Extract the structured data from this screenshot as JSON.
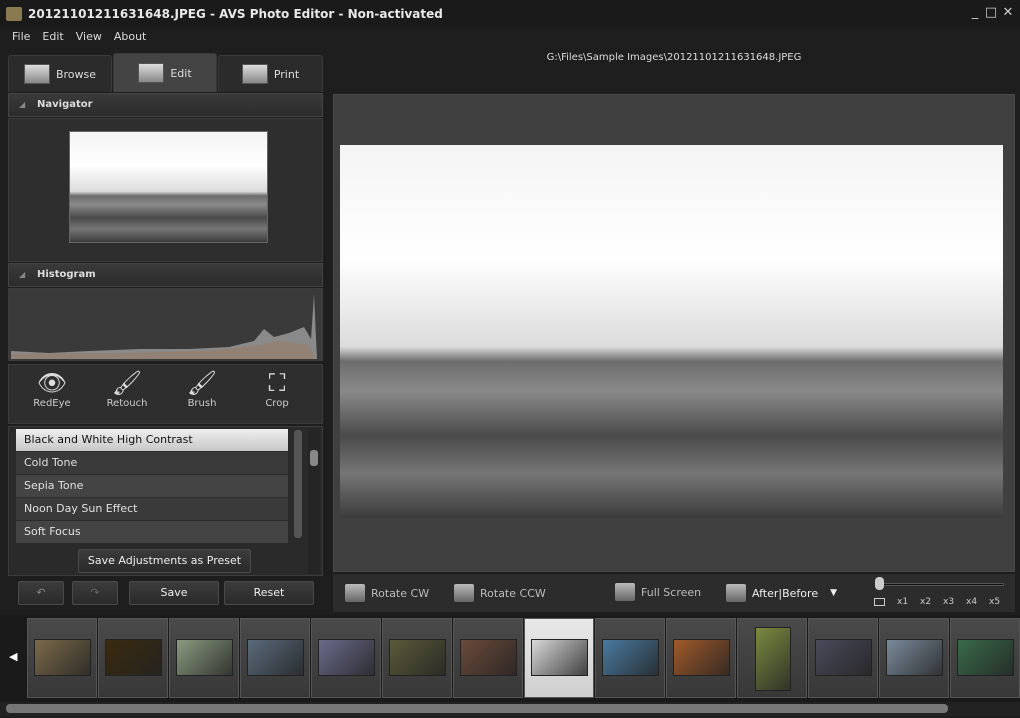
{
  "window": {
    "title": "20121101211631648.JPEG  -  AVS Photo Editor - Non-activated",
    "controls": [
      "minimize",
      "maximize",
      "close"
    ]
  },
  "menu": [
    "File",
    "Edit",
    "View",
    "About"
  ],
  "tabs": [
    {
      "label": "Browse",
      "active": false
    },
    {
      "label": "Edit",
      "active": true
    },
    {
      "label": "Print",
      "active": false
    }
  ],
  "file_path": "G:\\Files\\Sample Images\\20121101211631648.JPEG",
  "panels": {
    "navigator": "Navigator",
    "histogram": "Histogram"
  },
  "tools": [
    {
      "label": "RedEye",
      "icon": "eye-icon"
    },
    {
      "label": "Retouch",
      "icon": "retouch-brush-icon"
    },
    {
      "label": "Brush",
      "icon": "paint-brush-icon"
    },
    {
      "label": "Crop",
      "icon": "crop-icon"
    }
  ],
  "presets": {
    "items": [
      "Black and White High Contrast",
      "Cold Tone",
      "Sepia Tone",
      "Noon Day Sun Effect",
      "Soft Focus"
    ],
    "selected": 0,
    "save_label": "Save Adjustments as Preset"
  },
  "actions": {
    "save": "Save",
    "reset": "Reset"
  },
  "toolbar": {
    "rotate_cw": "Rotate CW",
    "rotate_ccw": "Rotate CCW",
    "full_screen": "Full Screen",
    "after_before": "After|Before",
    "zoom_levels": [
      "x1",
      "x2",
      "x3",
      "x4",
      "x5"
    ],
    "zoom_level": 0
  },
  "filmstrip": {
    "selected": 7,
    "thumb_colors": [
      "#7a6a4a",
      "#3a2a10",
      "#8a9a80",
      "#5a6a7a",
      "#6a6a8a",
      "#5a5a3a",
      "#6a4a3a",
      "#d8d8d8",
      "#4a7aa0",
      "#a05a2a",
      "#7a8a40",
      "#4a4a5a",
      "#7a8a9a",
      "#3a6a4a"
    ]
  }
}
